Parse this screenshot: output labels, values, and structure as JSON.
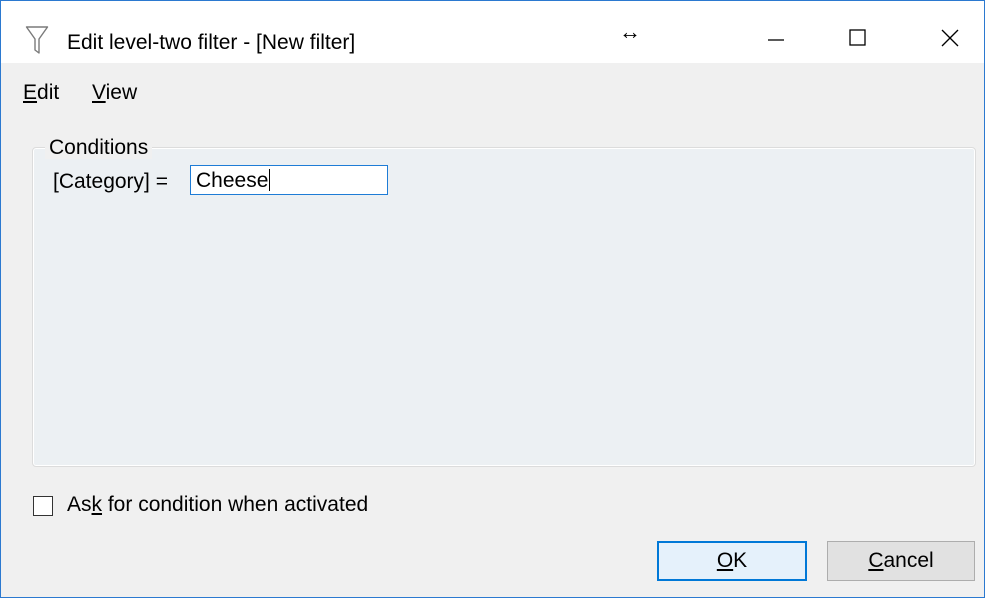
{
  "window": {
    "title": "Edit level-two filter - [New filter]",
    "app_icon": "funnel-icon",
    "resize_glyph": "↔",
    "controls": [
      "minimize-icon",
      "maximize-icon",
      "close-icon"
    ]
  },
  "menu": {
    "edit": {
      "mnemonic": "E",
      "rest": "dit"
    },
    "view": {
      "mnemonic": "V",
      "rest": "iew"
    }
  },
  "conditions": {
    "legend": "Conditions",
    "field_label": "[Category] =",
    "value": "Cheese"
  },
  "ask_checkbox": {
    "pre": "As",
    "mnemonic": "k",
    "post": " for condition when activated",
    "checked": false
  },
  "buttons": {
    "ok": {
      "mnemonic": "O",
      "rest": "K"
    },
    "cancel": {
      "mnemonic": "C",
      "rest": "ancel"
    }
  },
  "colors": {
    "accent": "#0078d7",
    "window_border": "#2b79d0",
    "dialog_bg": "#f0f0f0"
  }
}
